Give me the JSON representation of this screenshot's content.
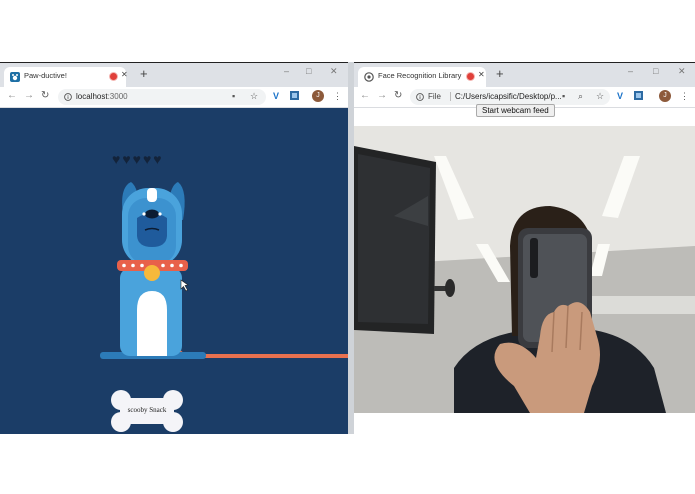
{
  "left_window": {
    "tab": {
      "title": "Paw-ductive!",
      "favicon": "paw-app-icon",
      "recording": true
    },
    "address": {
      "host": "localhost",
      "port": ":3000",
      "secure_icon": "info-icon"
    },
    "game": {
      "lives_total": 5,
      "lives_icon": "heart-icon",
      "snack_button_label": "scooby Snack",
      "colors": {
        "background": "#1b3d67",
        "dog_body": "#4aa3dc",
        "collar": "#e8614a",
        "leash": "#e8714f",
        "tag": "#f6b93b"
      }
    }
  },
  "right_window": {
    "tab": {
      "title": "Face Recognition Library",
      "favicon": "chrome-page-icon",
      "recording": true
    },
    "address": {
      "scheme_label": "File",
      "path": "C:/Users/icapsific/Desktop/p..."
    },
    "page": {
      "start_button_label": "Start webcam feed"
    }
  },
  "user_avatar_initial": "J",
  "window_controls": {
    "minimize": "–",
    "maximize": "□",
    "close": "✕"
  }
}
